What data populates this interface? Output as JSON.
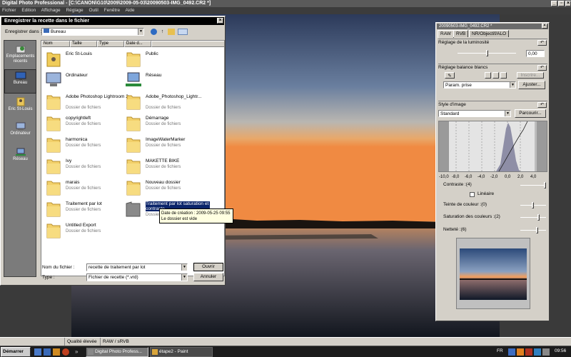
{
  "app": {
    "title": "Digital Photo Professional - [C:\\CANON\\G10\\2009\\2009-05-03\\20090503-IMG_0492.CR2 *]",
    "menu": [
      "Fichier",
      "Edition",
      "Affichage",
      "Réglage",
      "Outil",
      "Fenêtre",
      "Aide"
    ]
  },
  "dialog": {
    "title": "Enregistrer la recette dans le fichier",
    "save_in_label": "Enregistrer dans :",
    "save_in_value": "Bureau",
    "columns": [
      "Nom",
      "Taille",
      "Type",
      "Date d..."
    ],
    "places": [
      {
        "label": "Emplacements récents",
        "icon": "recent-places-icon"
      },
      {
        "label": "Bureau",
        "icon": "desktop-icon"
      },
      {
        "label": "Eric St-Louis",
        "icon": "user-folder-icon"
      },
      {
        "label": "Ordinateur",
        "icon": "computer-icon"
      },
      {
        "label": "Réseau",
        "icon": "network-icon"
      }
    ],
    "files": [
      {
        "name": "Eric St-Louis",
        "type": "",
        "icon": "user-folder-icon"
      },
      {
        "name": "Public",
        "type": "",
        "icon": "folder-icon"
      },
      {
        "name": "Ordinateur",
        "type": "",
        "icon": "computer-icon"
      },
      {
        "name": "Réseau",
        "type": "",
        "icon": "network-icon"
      },
      {
        "name": "Adobe Photoshop Lightroom 2",
        "type": "Dossier de fichiers",
        "icon": "folder-icon"
      },
      {
        "name": "Adobe_Photoshop_Lightr...",
        "type": "Dossier de fichiers",
        "icon": "folder-icon"
      },
      {
        "name": "copyrightleft",
        "type": "Dossier de fichiers",
        "icon": "folder-icon"
      },
      {
        "name": "Démarrage",
        "type": "Dossier de fichiers",
        "icon": "folder-icon"
      },
      {
        "name": "harmonica",
        "type": "Dossier de fichiers",
        "icon": "folder-icon"
      },
      {
        "name": "ImageWaterMarker",
        "type": "Dossier de fichiers",
        "icon": "folder-icon"
      },
      {
        "name": "Ivy",
        "type": "Dossier de fichiers",
        "icon": "folder-icon"
      },
      {
        "name": "MAKETTE BIKE",
        "type": "Dossier de fichiers",
        "icon": "folder-icon"
      },
      {
        "name": "marais",
        "type": "Dossier de fichiers",
        "icon": "folder-icon"
      },
      {
        "name": "Nouveau dossier",
        "type": "Dossier de fichiers",
        "icon": "folder-icon"
      },
      {
        "name": "Traitement par lot",
        "type": "Dossier de fichiers",
        "icon": "folder-icon"
      },
      {
        "name": "Traitement par lot saturation et contraste",
        "type": "Dossier de fichiers",
        "icon": "folder-gray-icon",
        "selected": true
      },
      {
        "name": "Untitled Export",
        "type": "Dossier de fichiers",
        "icon": "folder-icon"
      }
    ],
    "tooltip": {
      "line1": "Date de création : 2009-05-25 09:55",
      "line2": "Le dossier est vide"
    },
    "filename_label": "Nom du fichier :",
    "filename_value": "recette de traitement par lot",
    "type_label": "Type :",
    "type_value": "Fichier de recette (*.vrd)",
    "open_button": "Ouvrir",
    "cancel_button": "Annuler"
  },
  "tool": {
    "title": "20090503-IMG_0492.CR2 *",
    "tabs": [
      "RAW",
      "RVB",
      "NR/Objectif/ALO"
    ],
    "brightness_label": "Réglage de la luminosité",
    "brightness_value": "0,00",
    "wb_label": "Réglage balance blancs",
    "wb_reg": "Inscrire...",
    "wb_value": "Param. prise",
    "wb_adjust": "Ajuster...",
    "style_label": "Style d'image",
    "style_value": "Standard",
    "style_browse": "Parcourir...",
    "ticks": [
      "-10,0",
      "-8,0",
      "-6,0",
      "-4,0",
      "-2,0",
      "0,0",
      "2,0",
      "4,0"
    ],
    "contrast_label": "Contraste :(4)",
    "linear_label": "Linéaire",
    "hue_label": "Teinte de couleur :(0)",
    "saturation_label": "Saturation des couleurs :(2)",
    "sharpness_label": "Netteté :(6)"
  },
  "status": {
    "quality": "Qualité élevée",
    "format": "RAW / sRVB"
  },
  "taskbar": {
    "start": "Démarrer",
    "items": [
      "Digital Photo Profess...",
      "étape2 - Paint"
    ],
    "lang": "FR",
    "time": "09:56"
  }
}
